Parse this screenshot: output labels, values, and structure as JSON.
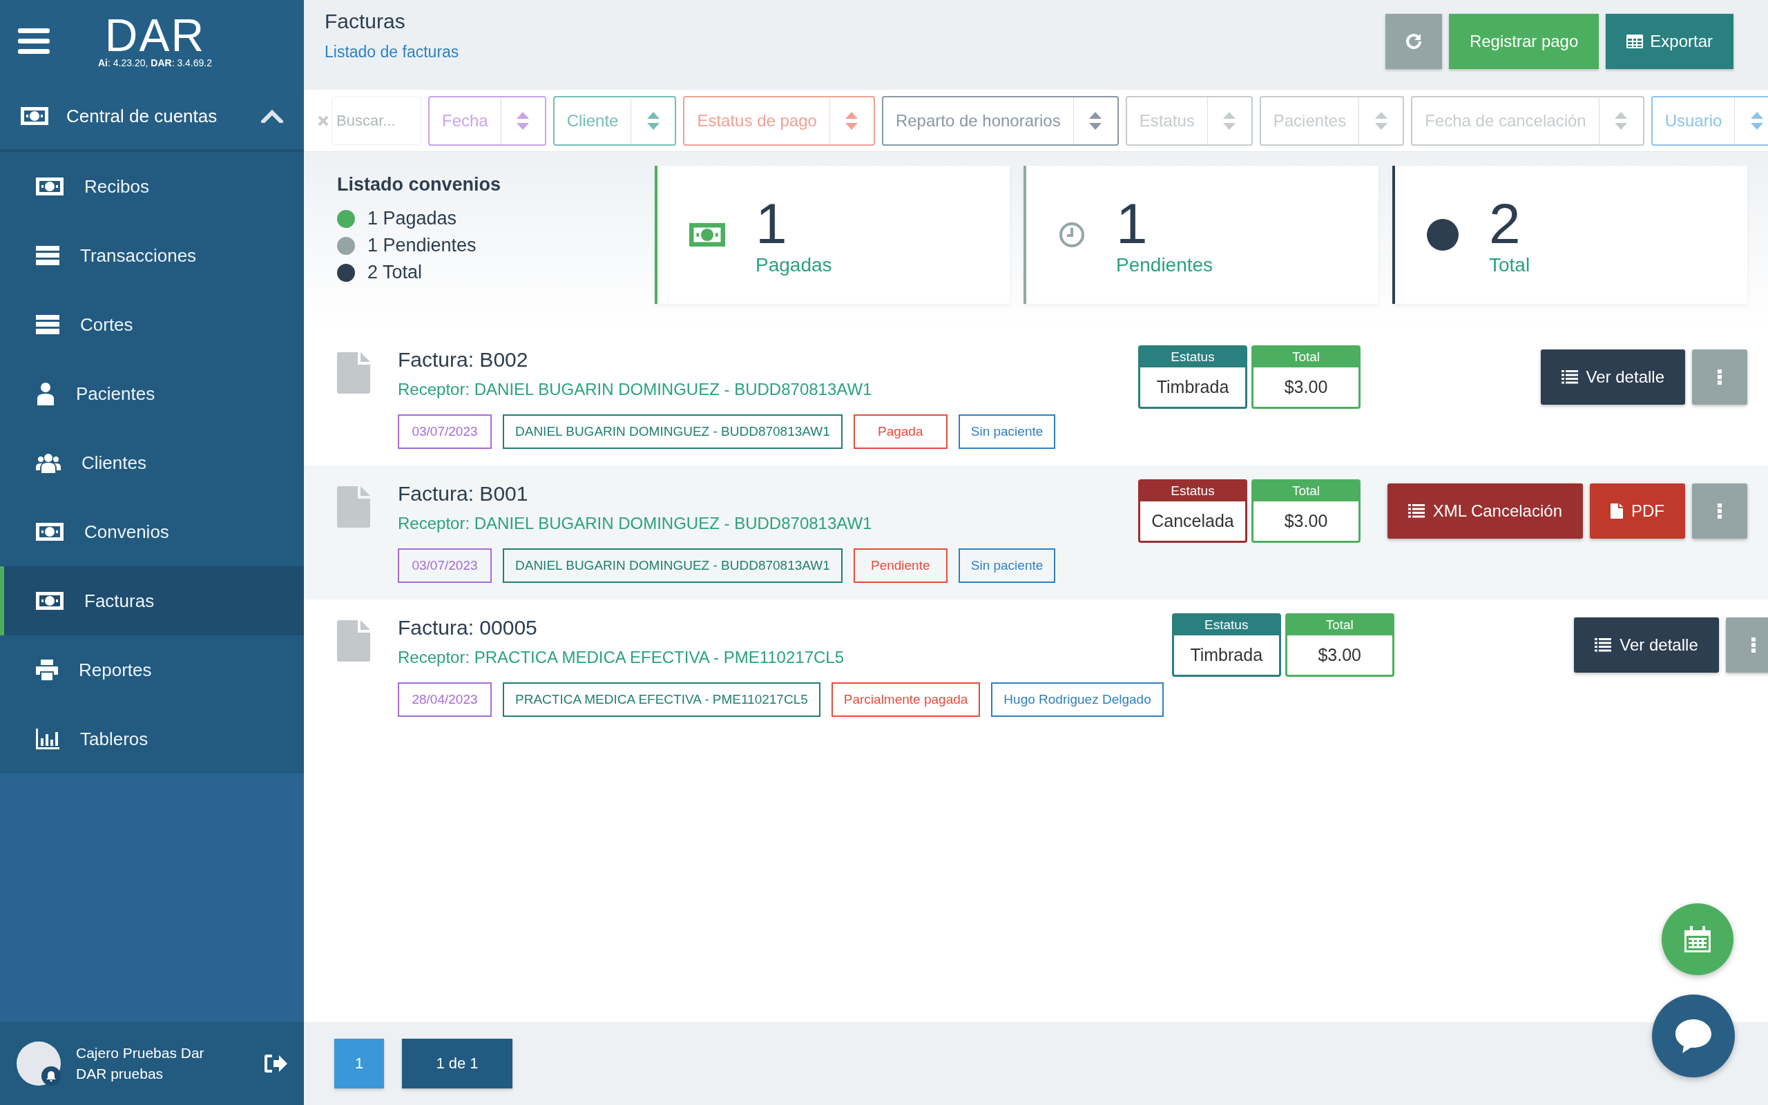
{
  "sidebar": {
    "brand": "DAR",
    "version": "**Ai**: 4.23.20, **DAR**: 3.4.69.2",
    "section": {
      "label": "Central de cuentas",
      "expanded": true
    },
    "items": [
      {
        "label": "Recibos",
        "selected": false
      },
      {
        "label": "Transacciones",
        "selected": false
      },
      {
        "label": "Cortes",
        "selected": false
      },
      {
        "label": "Pacientes",
        "selected": false
      },
      {
        "label": "Clientes",
        "selected": false
      },
      {
        "label": "Convenios",
        "selected": false
      },
      {
        "label": "Facturas",
        "selected": true
      },
      {
        "label": "Reportes",
        "selected": false
      },
      {
        "label": "Tableros",
        "selected": false
      }
    ],
    "user": {
      "name": "Cajero Pruebas Dar",
      "role": "DAR pruebas"
    }
  },
  "header": {
    "title": "Facturas",
    "subtitle": "Listado de facturas",
    "buttons": [
      {
        "kind": "refresh"
      },
      {
        "kind": "green",
        "label": "Registrar pago"
      },
      {
        "kind": "export",
        "label": "Exportar"
      }
    ]
  },
  "filters": {
    "search": {
      "placeholder": "Buscar..."
    },
    "selects": [
      {
        "label": "Fecha",
        "color": "#c9a3ea"
      },
      {
        "label": "Cliente",
        "color": "#76bdb7"
      },
      {
        "label": "Estatus de pago",
        "color": "#f0a195"
      },
      {
        "label": "Reparto de honorarios",
        "color": "#8c97a3"
      },
      {
        "label": "Estatus",
        "color": "#c5cccb"
      },
      {
        "label": "Pacientes",
        "color": "#c5cccb"
      },
      {
        "label": "Fecha de cancelación",
        "color": "#c5cccb"
      },
      {
        "label": "Usuario",
        "color": "#8cc3ea"
      }
    ]
  },
  "summary": {
    "title": "Listado convenios",
    "legend": [
      {
        "text": "1 Pagadas",
        "color": "#4caf5f"
      },
      {
        "text": "1 Pendientes",
        "color": "#95a5a6"
      },
      {
        "text": "2 Total",
        "color": "#2c3e50"
      }
    ],
    "cards": [
      {
        "value": "1",
        "label": "Pagadas",
        "color": "#4caf5f"
      },
      {
        "value": "1",
        "label": "Pendientes",
        "color": "#95a5a6"
      },
      {
        "value": "2",
        "label": "Total",
        "color": "#2c3e50"
      }
    ]
  },
  "invoices": [
    {
      "title": "Factura: B002",
      "receptor": "Receptor: DANIEL BUGARIN DOMINGUEZ - BUDD870813AW1",
      "tags": [
        {
          "text": "03/07/2023",
          "color": "#a66bdc"
        },
        {
          "text": "DANIEL BUGARIN DOMINGUEZ - BUDD870813AW1",
          "color": "#1f7f72"
        },
        {
          "text": "Pagada",
          "color": "#e74c3c"
        },
        {
          "text": "Sin paciente",
          "color": "#2f80c0"
        }
      ],
      "status_label": "Estatus",
      "status": {
        "text": "Timbrada",
        "color": "#2a7f7f"
      },
      "total_label": "Total",
      "total": "$3.00",
      "actions": [
        {
          "kind": "detail",
          "label": "Ver detalle"
        },
        {
          "kind": "more"
        }
      ]
    },
    {
      "title": "Factura: B001",
      "receptor": "Receptor: DANIEL BUGARIN DOMINGUEZ - BUDD870813AW1",
      "tags": [
        {
          "text": "03/07/2023",
          "color": "#a66bdc"
        },
        {
          "text": "DANIEL BUGARIN DOMINGUEZ - BUDD870813AW1",
          "color": "#1f7f72"
        },
        {
          "text": "Pendiente",
          "color": "#e74c3c"
        },
        {
          "text": "Sin paciente",
          "color": "#2f80c0"
        }
      ],
      "status_label": "Estatus",
      "status": {
        "text": "Cancelada",
        "color": "#9b3030"
      },
      "total_label": "Total",
      "total": "$3.00",
      "actions": [
        {
          "kind": "xml",
          "label": "XML Cancelación"
        },
        {
          "kind": "pdf",
          "label": "PDF"
        },
        {
          "kind": "more"
        }
      ]
    },
    {
      "title": "Factura: 00005",
      "receptor": "Receptor: PRACTICA MEDICA EFECTIVA - PME110217CL5",
      "tags": [
        {
          "text": "28/04/2023",
          "color": "#a66bdc"
        },
        {
          "text": "PRACTICA MEDICA EFECTIVA - PME110217CL5",
          "color": "#1f7f72"
        },
        {
          "text": "Parcialmente pagada",
          "color": "#e74c3c"
        },
        {
          "text": "Hugo Rodriguez Delgado",
          "color": "#2f80c0"
        }
      ],
      "status_label": "Estatus",
      "status": {
        "text": "Timbrada",
        "color": "#2a7f7f"
      },
      "total_label": "Total",
      "total": "$3.00",
      "actions": [
        {
          "kind": "detail",
          "label": "Ver detalle"
        },
        {
          "kind": "more"
        }
      ]
    }
  ],
  "pagination": {
    "pages": [
      {
        "label": "1",
        "selected": true
      }
    ],
    "summary": "1 de 1"
  }
}
